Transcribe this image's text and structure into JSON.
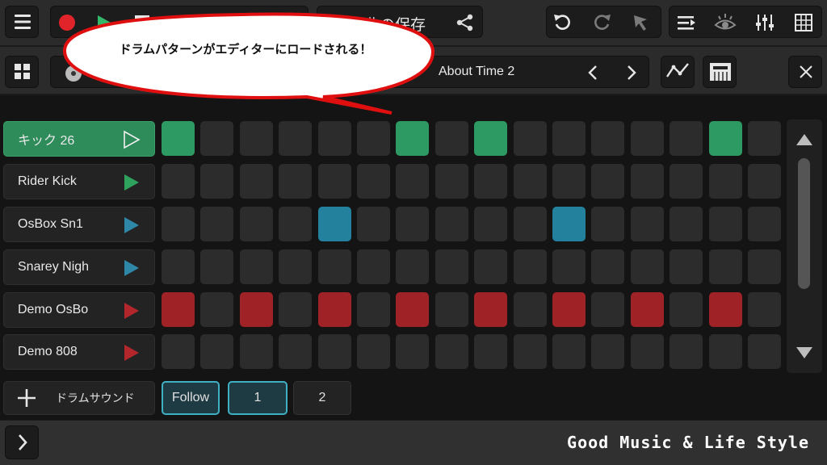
{
  "topbar": {
    "song_title_partial": "曲の保存",
    "icons": [
      "menu-icon",
      "record-icon",
      "play-icon",
      "stop-icon",
      "share-icon",
      "undo-icon",
      "redo-icon",
      "pointer-icon",
      "list-icon",
      "eye-icon",
      "mixer-icon",
      "grid-icon"
    ]
  },
  "secondbar": {
    "pattern_name": "About Time 2"
  },
  "callout": {
    "text": "ドラムパターンがエディターにロードされる！"
  },
  "tracks": [
    {
      "name": "キック 26",
      "play_color": "#f0f0f0",
      "active": true
    },
    {
      "name": "Rider Kick",
      "play_color": "#2fa35e",
      "active": false
    },
    {
      "name": "OsBox Sn1",
      "play_color": "#2f87a8",
      "active": false
    },
    {
      "name": "Snarey Nigh",
      "play_color": "#2f87a8",
      "active": false
    },
    {
      "name": "Demo OsBo",
      "play_color": "#b3262b",
      "active": false
    },
    {
      "name": "Demo 808",
      "play_color": "#b3262b",
      "active": false
    }
  ],
  "steps": [
    [
      1,
      0,
      0,
      0,
      0,
      0,
      1,
      0,
      1,
      0,
      0,
      0,
      0,
      0,
      1,
      0
    ],
    [
      0,
      0,
      0,
      0,
      0,
      0,
      0,
      0,
      0,
      0,
      0,
      0,
      0,
      0,
      0,
      0
    ],
    [
      0,
      0,
      0,
      0,
      1,
      0,
      0,
      0,
      0,
      0,
      1,
      0,
      0,
      0,
      0,
      0
    ],
    [
      0,
      0,
      0,
      0,
      0,
      0,
      0,
      0,
      0,
      0,
      0,
      0,
      0,
      0,
      0,
      0
    ],
    [
      1,
      0,
      1,
      0,
      1,
      0,
      1,
      0,
      1,
      0,
      1,
      0,
      1,
      0,
      1,
      0
    ],
    [
      0,
      0,
      0,
      0,
      0,
      0,
      0,
      0,
      0,
      0,
      0,
      0,
      0,
      0,
      0,
      0
    ]
  ],
  "row_colors": [
    "#2e9a63",
    "#2e9a63",
    "#23819e",
    "#23819e",
    "#9e2226",
    "#9e2226"
  ],
  "bottom": {
    "add_label": "ドラムサウンド",
    "follow_label": "Follow",
    "page1_label": "1",
    "page2_label": "2"
  },
  "footer": {
    "tagline": "Good Music & Life Style"
  },
  "colors": {
    "accent": "#2e8b5a",
    "follow_border": "#3fb0c4"
  }
}
